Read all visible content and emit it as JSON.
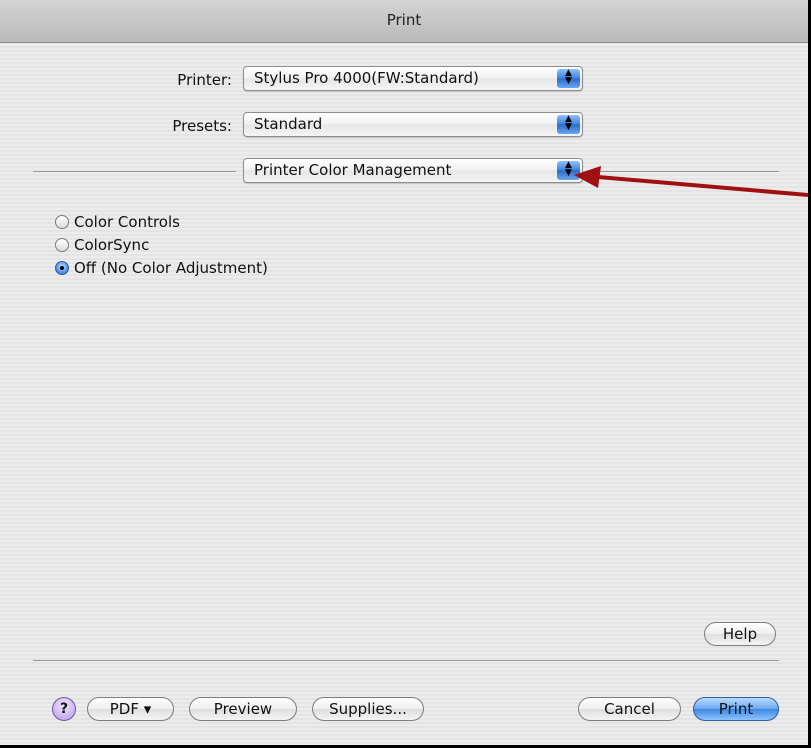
{
  "window": {
    "title": "Print"
  },
  "printer": {
    "label": "Printer:",
    "value": "Stylus Pro 4000(FW:Standard)"
  },
  "presets": {
    "label": "Presets:",
    "value": "Standard"
  },
  "panel": {
    "value": "Printer Color Management"
  },
  "color_options": [
    {
      "label": "Color Controls",
      "selected": false
    },
    {
      "label": "ColorSync",
      "selected": false
    },
    {
      "label": "Off (No Color Adjustment)",
      "selected": true
    }
  ],
  "buttons": {
    "help": "Help",
    "help_icon": "?",
    "pdf": "PDF ▾",
    "preview": "Preview",
    "supplies": "Supplies...",
    "cancel": "Cancel",
    "print": "Print"
  },
  "annotation": {
    "arrow_color": "#a01010"
  }
}
